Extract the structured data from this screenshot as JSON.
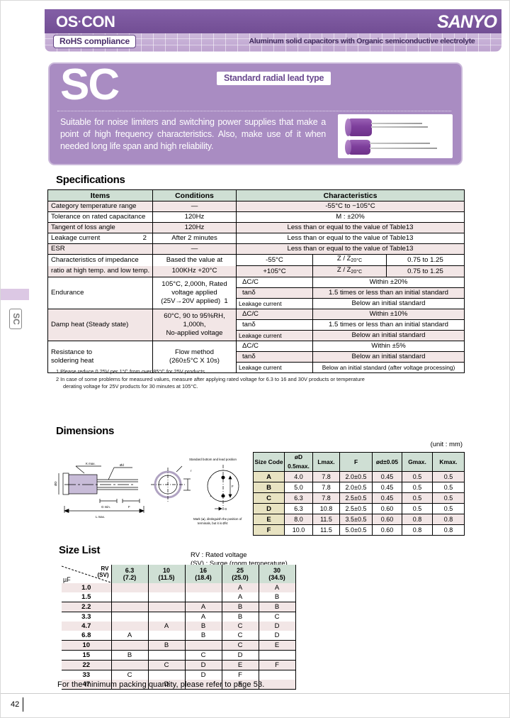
{
  "header": {
    "brand_logo": "OS-CON",
    "brand_logo_parts": {
      "left": "OS",
      "mid": "·",
      "right": "CON"
    },
    "company_logo": "SANYO",
    "rohs_badge": "RoHS compliance",
    "tagline": "Aluminum solid capacitors with Organic semiconductive electrolyte",
    "accent_color": "#7b589e",
    "sub_bar_color": "#c9b4d8"
  },
  "hero": {
    "series": "SC",
    "badge": "Standard radial lead type",
    "description": "Suitable for noise limiters and switching power supplies that make a point of high frequency characteristics. Also, make use of it when needed long life span and high reliability.",
    "panel_color": "#a98cc2"
  },
  "side_tab": {
    "label": "SC"
  },
  "specifications": {
    "title": "Specifications",
    "columns": [
      "Items",
      "Conditions",
      "Characteristics"
    ],
    "rows": [
      {
        "item": "Category  temperature  range",
        "item_note": "",
        "condition": "—",
        "char": "-55°C to −105°C",
        "shade": "pink"
      },
      {
        "item": "Tolerance  on  rated  capacitance",
        "item_note": "",
        "condition": "120Hz",
        "char": "M  : ±20%",
        "shade": "white"
      },
      {
        "item": "Tangent  of  loss  angle",
        "item_note": "",
        "condition": "120Hz",
        "char": "Less  than  or  equal  to  the  value  of  Table13",
        "shade": "pink"
      },
      {
        "item": "Leakage  current",
        "item_note": "2",
        "condition": "After 2 minutes",
        "char": "Less  than  or  equal  to  the  value  of  Table13",
        "shade": "white"
      },
      {
        "item": "ESR",
        "item_note": "",
        "condition": "—",
        "char": "Less  than  or  equal  to  the  value  of  Table13",
        "shade": "pink"
      }
    ],
    "impedance": {
      "item_line1": "Characteristics of impedance",
      "item_line2": "ratio at high temp. and low temp.",
      "cond_line1": "Based the value at",
      "cond_line2": "100KHz   +20°C",
      "sub_rows": [
        {
          "temp": "-55°C",
          "ratio": "Z / Z",
          "ratio_sub": "20°C",
          "value": "0.75 to 1.25",
          "shade": "white"
        },
        {
          "temp": "+105°C",
          "ratio": "Z / Z",
          "ratio_sub": "20°C",
          "value": "0.75 to 1.25",
          "shade": "pink"
        }
      ]
    },
    "endurance": {
      "item": "Endurance",
      "cond_line1": "105°C, 2,000h, Rated",
      "cond_line2": "voltage  applied",
      "cond_line3": "(25V→20V applied)",
      "cond_note": "1",
      "sub_rows": [
        {
          "param": "ΔC/C",
          "result": "Within  ±20%",
          "shade": "white"
        },
        {
          "param": "tanδ",
          "result": "1.5  times  or  less  than  an  initial  standard",
          "shade": "pink"
        },
        {
          "param": "Leakage current",
          "result": "Below  an  initial  standard",
          "shade": "white"
        }
      ]
    },
    "damp_heat": {
      "item": "Damp  heat (Steady  state)",
      "cond_line1": "60°C, 90 to 95%RH,",
      "cond_line2": "1,000h,",
      "cond_line3": "No-applied voltage",
      "sub_rows": [
        {
          "param": "ΔC/C",
          "result": "Within  ±10%",
          "shade": "pink"
        },
        {
          "param": "tanδ",
          "result": "1.5  times  or  less  than  an  initial  standard",
          "shade": "white"
        },
        {
          "param": "Leakage current",
          "result": "Below  an  initial  standard",
          "shade": "pink"
        }
      ]
    },
    "soldering": {
      "item_line1": "Resistance  to",
      "item_line2": "soldering  heat",
      "cond_line1": "Flow method",
      "cond_line2": "(260±5°C X 10s)",
      "sub_rows": [
        {
          "param": "ΔC/C",
          "result": "Within ±5%",
          "shade": "white"
        },
        {
          "param": "tanδ",
          "result": "Below  an  initial  standard",
          "shade": "pink"
        },
        {
          "param": "Leakage current",
          "result": "Below an initial standard (after voltage processing)",
          "shade": "white"
        }
      ]
    },
    "footnotes": [
      "1  Please reduce 0.25V per 1°C from over 85°C for 25V products.",
      "2  In case of some problems for measured values, measure after applying rated voltage for 6.3 to 16 and 30V products or temperature",
      "derating voltage for 25V products for 30 minutes at 105°C."
    ]
  },
  "dimensions": {
    "title": "Dimensions",
    "unit_note": "(unit : mm)",
    "columns": [
      "Size Code",
      "øD 0.5max.",
      "Lmax.",
      "F",
      "ød±0.05",
      "Gmax.",
      "Kmax."
    ],
    "rows": [
      {
        "code": "A",
        "D": "4.0",
        "L": "7.8",
        "F": "2.0±0.5",
        "d": "0.45",
        "G": "0.5",
        "K": "0.5"
      },
      {
        "code": "B",
        "D": "5.0",
        "L": "7.8",
        "F": "2.0±0.5",
        "d": "0.45",
        "G": "0.5",
        "K": "0.5"
      },
      {
        "code": "C",
        "D": "6.3",
        "L": "7.8",
        "F": "2.5±0.5",
        "d": "0.45",
        "G": "0.5",
        "K": "0.5"
      },
      {
        "code": "D",
        "D": "6.3",
        "L": "10.8",
        "F": "2.5±0.5",
        "d": "0.60",
        "G": "0.5",
        "K": "0.5"
      },
      {
        "code": "E",
        "D": "8.0",
        "L": "11.5",
        "F": "3.5±0.5",
        "d": "0.60",
        "G": "0.8",
        "K": "0.8"
      },
      {
        "code": "F",
        "D": "10.0",
        "L": "11.5",
        "F": "5.0±0.5",
        "d": "0.60",
        "G": "0.8",
        "K": "0.8"
      }
    ],
    "drawing": {
      "label_top": "K max.",
      "label_lead": "ød",
      "label_diameter": "øD",
      "label_g": "G min.",
      "label_f": "F",
      "label_length": "L max.",
      "label_polarity": "Standard bottom and lead position",
      "label_minus": "−",
      "label_plus": "+",
      "label_note": "Mark (●), distinguish the position of terminals, but it is ø / 4"
    }
  },
  "size_list": {
    "title": "Size  List",
    "legend_line1": "RV  : Rated voltage",
    "legend_line2": "(SV) : Surge (room temperature)",
    "corner_rv": "RV",
    "corner_sv": "(SV)",
    "corner_uf": "µF",
    "voltages": [
      {
        "rv": "6.3",
        "sv": "(7.2)"
      },
      {
        "rv": "10",
        "sv": "(11.5)"
      },
      {
        "rv": "16",
        "sv": "(18.4)"
      },
      {
        "rv": "25",
        "sv": "(25.0)"
      },
      {
        "rv": "30",
        "sv": "(34.5)"
      }
    ],
    "rows": [
      {
        "uf": "1.0",
        "cells": [
          "",
          "",
          "",
          "A",
          "A"
        ],
        "shade": "pink",
        "boxed": false
      },
      {
        "uf": "1.5",
        "cells": [
          "",
          "",
          "",
          "A",
          "B"
        ],
        "shade": "white",
        "boxed": false
      },
      {
        "uf": "2.2",
        "cells": [
          "",
          "",
          "A",
          "B",
          "B"
        ],
        "shade": "pink",
        "boxed": true
      },
      {
        "uf": "3.3",
        "cells": [
          "",
          "",
          "A",
          "B",
          "C"
        ],
        "shade": "white",
        "boxed": false
      },
      {
        "uf": "4.7",
        "cells": [
          "",
          "A",
          "B",
          "C",
          "D"
        ],
        "shade": "pink",
        "boxed": false
      },
      {
        "uf": "6.8",
        "cells": [
          "A",
          "",
          "B",
          "C",
          "D"
        ],
        "shade": "white",
        "boxed": false
      },
      {
        "uf": "10",
        "cells": [
          "",
          "B",
          "",
          "C",
          "E"
        ],
        "shade": "pink",
        "boxed": true
      },
      {
        "uf": "15",
        "cells": [
          "B",
          "",
          "C",
          "D",
          ""
        ],
        "shade": "white",
        "boxed": false
      },
      {
        "uf": "22",
        "cells": [
          "",
          "C",
          "D",
          "E",
          "F"
        ],
        "shade": "pink",
        "boxed": true
      },
      {
        "uf": "33",
        "cells": [
          "C",
          "",
          "D",
          "F",
          ""
        ],
        "shade": "white",
        "boxed": false
      },
      {
        "uf": "47",
        "cells": [
          "",
          "D",
          "",
          "F",
          ""
        ],
        "shade": "pink",
        "boxed": false
      }
    ]
  },
  "footer": {
    "packing_note": "For  the  minimum  packing  quantity,  please  refer  to  page  53.",
    "page_number": "42"
  }
}
